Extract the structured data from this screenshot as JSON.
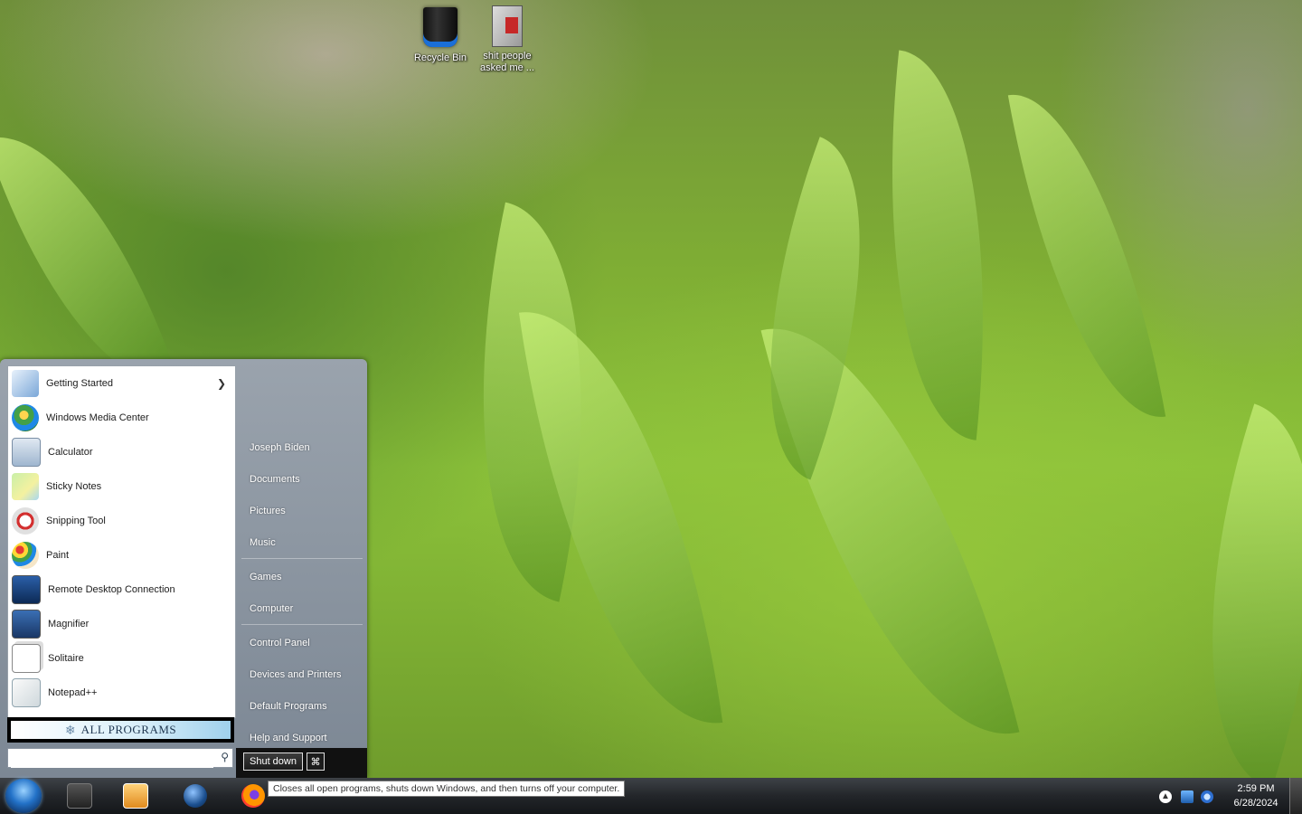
{
  "desktop": {
    "icons": [
      {
        "label": "Recycle Bin"
      },
      {
        "label": "shit people asked me ..."
      }
    ]
  },
  "start_menu": {
    "programs": [
      {
        "label": "Getting Started",
        "icon": "getting-started-icon",
        "has_submenu": true
      },
      {
        "label": "Windows Media Center",
        "icon": "windows-media-center-icon"
      },
      {
        "label": "Calculator",
        "icon": "calculator-icon"
      },
      {
        "label": "Sticky Notes",
        "icon": "sticky-notes-icon"
      },
      {
        "label": "Snipping Tool",
        "icon": "snipping-tool-icon"
      },
      {
        "label": "Paint",
        "icon": "paint-icon"
      },
      {
        "label": "Remote Desktop Connection",
        "icon": "remote-desktop-icon"
      },
      {
        "label": "Magnifier",
        "icon": "magnifier-icon"
      },
      {
        "label": "Solitaire",
        "icon": "solitaire-icon"
      },
      {
        "label": "Notepad++",
        "icon": "notepad-plus-plus-icon"
      }
    ],
    "all_programs_label": "ALL PROGRAMS",
    "search_value": "",
    "right_links": [
      {
        "label": "Joseph Biden"
      },
      {
        "label": "Documents"
      },
      {
        "label": "Pictures"
      },
      {
        "label": "Music"
      },
      {
        "label": "Games"
      },
      {
        "label": "Computer"
      },
      {
        "label": "Control Panel"
      },
      {
        "label": "Devices and Printers"
      },
      {
        "label": "Default Programs"
      },
      {
        "label": "Help and Support"
      }
    ],
    "shutdown_label": "Shut down",
    "shutdown_tooltip": "Closes all open programs, shuts down Windows, and then turns off your computer."
  },
  "taskbar": {
    "pinned": [
      {
        "icon": "file-explorer-icon"
      },
      {
        "icon": "media-player-icon"
      },
      {
        "icon": "globe-icon"
      },
      {
        "icon": "firefox-icon"
      }
    ],
    "clock": {
      "time": "2:59 PM",
      "date": "6/28/2024"
    },
    "colors": {
      "accent": "#2372c8",
      "taskbar": "#23262a"
    }
  }
}
